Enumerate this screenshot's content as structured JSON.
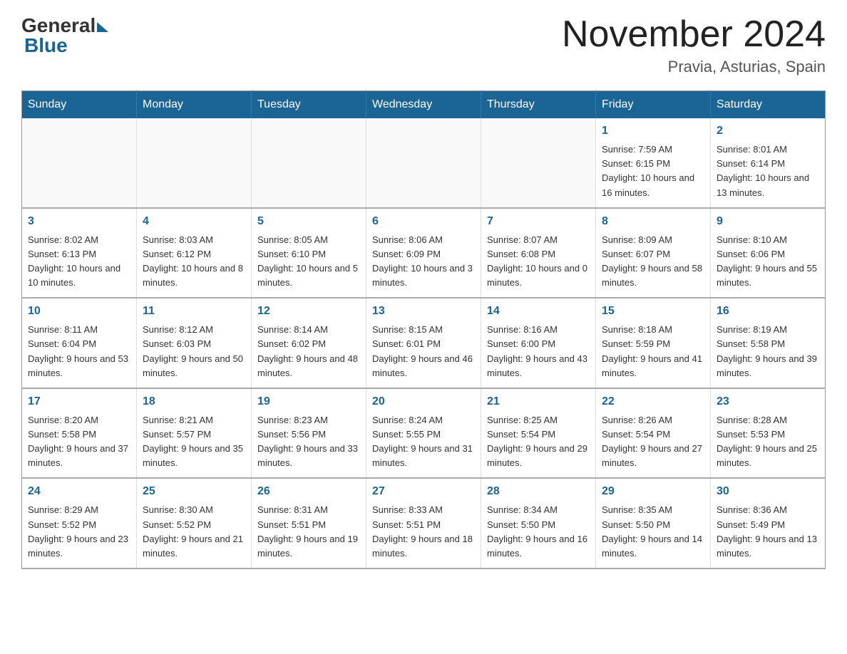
{
  "logo": {
    "general": "General",
    "blue": "Blue"
  },
  "title": {
    "month_year": "November 2024",
    "location": "Pravia, Asturias, Spain"
  },
  "headers": [
    "Sunday",
    "Monday",
    "Tuesday",
    "Wednesday",
    "Thursday",
    "Friday",
    "Saturday"
  ],
  "weeks": [
    [
      {
        "day": "",
        "info": ""
      },
      {
        "day": "",
        "info": ""
      },
      {
        "day": "",
        "info": ""
      },
      {
        "day": "",
        "info": ""
      },
      {
        "day": "",
        "info": ""
      },
      {
        "day": "1",
        "info": "Sunrise: 7:59 AM\nSunset: 6:15 PM\nDaylight: 10 hours and 16 minutes."
      },
      {
        "day": "2",
        "info": "Sunrise: 8:01 AM\nSunset: 6:14 PM\nDaylight: 10 hours and 13 minutes."
      }
    ],
    [
      {
        "day": "3",
        "info": "Sunrise: 8:02 AM\nSunset: 6:13 PM\nDaylight: 10 hours and 10 minutes."
      },
      {
        "day": "4",
        "info": "Sunrise: 8:03 AM\nSunset: 6:12 PM\nDaylight: 10 hours and 8 minutes."
      },
      {
        "day": "5",
        "info": "Sunrise: 8:05 AM\nSunset: 6:10 PM\nDaylight: 10 hours and 5 minutes."
      },
      {
        "day": "6",
        "info": "Sunrise: 8:06 AM\nSunset: 6:09 PM\nDaylight: 10 hours and 3 minutes."
      },
      {
        "day": "7",
        "info": "Sunrise: 8:07 AM\nSunset: 6:08 PM\nDaylight: 10 hours and 0 minutes."
      },
      {
        "day": "8",
        "info": "Sunrise: 8:09 AM\nSunset: 6:07 PM\nDaylight: 9 hours and 58 minutes."
      },
      {
        "day": "9",
        "info": "Sunrise: 8:10 AM\nSunset: 6:06 PM\nDaylight: 9 hours and 55 minutes."
      }
    ],
    [
      {
        "day": "10",
        "info": "Sunrise: 8:11 AM\nSunset: 6:04 PM\nDaylight: 9 hours and 53 minutes."
      },
      {
        "day": "11",
        "info": "Sunrise: 8:12 AM\nSunset: 6:03 PM\nDaylight: 9 hours and 50 minutes."
      },
      {
        "day": "12",
        "info": "Sunrise: 8:14 AM\nSunset: 6:02 PM\nDaylight: 9 hours and 48 minutes."
      },
      {
        "day": "13",
        "info": "Sunrise: 8:15 AM\nSunset: 6:01 PM\nDaylight: 9 hours and 46 minutes."
      },
      {
        "day": "14",
        "info": "Sunrise: 8:16 AM\nSunset: 6:00 PM\nDaylight: 9 hours and 43 minutes."
      },
      {
        "day": "15",
        "info": "Sunrise: 8:18 AM\nSunset: 5:59 PM\nDaylight: 9 hours and 41 minutes."
      },
      {
        "day": "16",
        "info": "Sunrise: 8:19 AM\nSunset: 5:58 PM\nDaylight: 9 hours and 39 minutes."
      }
    ],
    [
      {
        "day": "17",
        "info": "Sunrise: 8:20 AM\nSunset: 5:58 PM\nDaylight: 9 hours and 37 minutes."
      },
      {
        "day": "18",
        "info": "Sunrise: 8:21 AM\nSunset: 5:57 PM\nDaylight: 9 hours and 35 minutes."
      },
      {
        "day": "19",
        "info": "Sunrise: 8:23 AM\nSunset: 5:56 PM\nDaylight: 9 hours and 33 minutes."
      },
      {
        "day": "20",
        "info": "Sunrise: 8:24 AM\nSunset: 5:55 PM\nDaylight: 9 hours and 31 minutes."
      },
      {
        "day": "21",
        "info": "Sunrise: 8:25 AM\nSunset: 5:54 PM\nDaylight: 9 hours and 29 minutes."
      },
      {
        "day": "22",
        "info": "Sunrise: 8:26 AM\nSunset: 5:54 PM\nDaylight: 9 hours and 27 minutes."
      },
      {
        "day": "23",
        "info": "Sunrise: 8:28 AM\nSunset: 5:53 PM\nDaylight: 9 hours and 25 minutes."
      }
    ],
    [
      {
        "day": "24",
        "info": "Sunrise: 8:29 AM\nSunset: 5:52 PM\nDaylight: 9 hours and 23 minutes."
      },
      {
        "day": "25",
        "info": "Sunrise: 8:30 AM\nSunset: 5:52 PM\nDaylight: 9 hours and 21 minutes."
      },
      {
        "day": "26",
        "info": "Sunrise: 8:31 AM\nSunset: 5:51 PM\nDaylight: 9 hours and 19 minutes."
      },
      {
        "day": "27",
        "info": "Sunrise: 8:33 AM\nSunset: 5:51 PM\nDaylight: 9 hours and 18 minutes."
      },
      {
        "day": "28",
        "info": "Sunrise: 8:34 AM\nSunset: 5:50 PM\nDaylight: 9 hours and 16 minutes."
      },
      {
        "day": "29",
        "info": "Sunrise: 8:35 AM\nSunset: 5:50 PM\nDaylight: 9 hours and 14 minutes."
      },
      {
        "day": "30",
        "info": "Sunrise: 8:36 AM\nSunset: 5:49 PM\nDaylight: 9 hours and 13 minutes."
      }
    ]
  ]
}
